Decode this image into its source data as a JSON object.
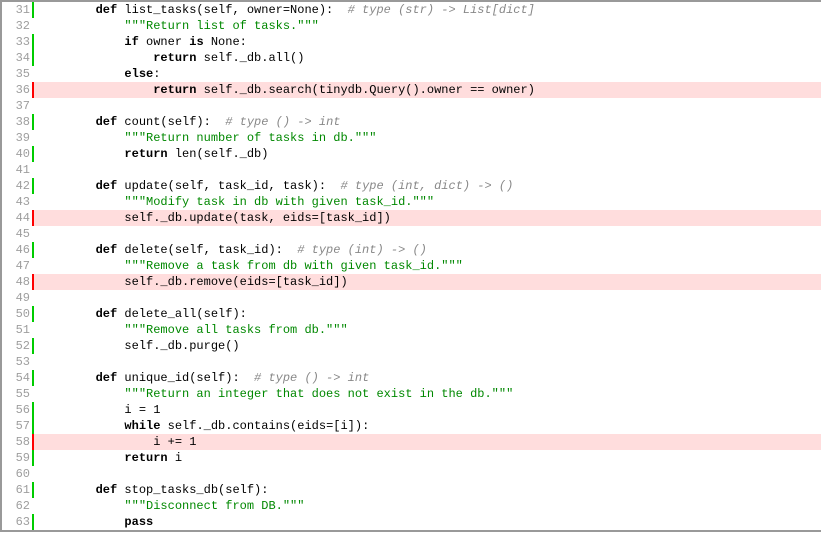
{
  "lines": [
    {
      "n": 31,
      "bar": "green",
      "status": "hit",
      "segments": [
        {
          "t": "        ",
          "c": ""
        },
        {
          "t": "def",
          "c": "kw"
        },
        {
          "t": " list_tasks(self, owner=None):  ",
          "c": ""
        },
        {
          "t": "# type (str) -> List[dict]",
          "c": "cmt"
        }
      ]
    },
    {
      "n": 32,
      "bar": "",
      "status": "none",
      "segments": [
        {
          "t": "            ",
          "c": ""
        },
        {
          "t": "\"\"\"Return list of tasks.\"\"\"",
          "c": "str"
        }
      ]
    },
    {
      "n": 33,
      "bar": "green",
      "status": "hit",
      "segments": [
        {
          "t": "            ",
          "c": ""
        },
        {
          "t": "if",
          "c": "kw"
        },
        {
          "t": " owner ",
          "c": ""
        },
        {
          "t": "is",
          "c": "kw"
        },
        {
          "t": " None:",
          "c": ""
        }
      ]
    },
    {
      "n": 34,
      "bar": "green",
      "status": "hit",
      "segments": [
        {
          "t": "                ",
          "c": ""
        },
        {
          "t": "return",
          "c": "kw"
        },
        {
          "t": " self._db.all()",
          "c": ""
        }
      ]
    },
    {
      "n": 35,
      "bar": "",
      "status": "none",
      "segments": [
        {
          "t": "            ",
          "c": ""
        },
        {
          "t": "else",
          "c": "kw"
        },
        {
          "t": ":",
          "c": ""
        }
      ]
    },
    {
      "n": 36,
      "bar": "red",
      "status": "miss",
      "segments": [
        {
          "t": "                ",
          "c": ""
        },
        {
          "t": "return",
          "c": "kw"
        },
        {
          "t": " self._db.search(tinydb.Query().owner == owner)",
          "c": ""
        }
      ]
    },
    {
      "n": 37,
      "bar": "",
      "status": "none",
      "segments": []
    },
    {
      "n": 38,
      "bar": "green",
      "status": "hit",
      "segments": [
        {
          "t": "        ",
          "c": ""
        },
        {
          "t": "def",
          "c": "kw"
        },
        {
          "t": " count(self):  ",
          "c": ""
        },
        {
          "t": "# type () -> int",
          "c": "cmt"
        }
      ]
    },
    {
      "n": 39,
      "bar": "",
      "status": "none",
      "segments": [
        {
          "t": "            ",
          "c": ""
        },
        {
          "t": "\"\"\"Return number of tasks in db.\"\"\"",
          "c": "str"
        }
      ]
    },
    {
      "n": 40,
      "bar": "green",
      "status": "hit",
      "segments": [
        {
          "t": "            ",
          "c": ""
        },
        {
          "t": "return",
          "c": "kw"
        },
        {
          "t": " len(self._db)",
          "c": ""
        }
      ]
    },
    {
      "n": 41,
      "bar": "",
      "status": "none",
      "segments": []
    },
    {
      "n": 42,
      "bar": "green",
      "status": "hit",
      "segments": [
        {
          "t": "        ",
          "c": ""
        },
        {
          "t": "def",
          "c": "kw"
        },
        {
          "t": " update(self, task_id, task):  ",
          "c": ""
        },
        {
          "t": "# type (int, dict) -> ()",
          "c": "cmt"
        }
      ]
    },
    {
      "n": 43,
      "bar": "",
      "status": "none",
      "segments": [
        {
          "t": "            ",
          "c": ""
        },
        {
          "t": "\"\"\"Modify task in db with given task_id.\"\"\"",
          "c": "str"
        }
      ]
    },
    {
      "n": 44,
      "bar": "red",
      "status": "miss",
      "segments": [
        {
          "t": "            self._db.update(task, eids=[task_id])",
          "c": ""
        }
      ]
    },
    {
      "n": 45,
      "bar": "",
      "status": "none",
      "segments": []
    },
    {
      "n": 46,
      "bar": "green",
      "status": "hit",
      "segments": [
        {
          "t": "        ",
          "c": ""
        },
        {
          "t": "def",
          "c": "kw"
        },
        {
          "t": " delete(self, task_id):  ",
          "c": ""
        },
        {
          "t": "# type (int) -> ()",
          "c": "cmt"
        }
      ]
    },
    {
      "n": 47,
      "bar": "",
      "status": "none",
      "segments": [
        {
          "t": "            ",
          "c": ""
        },
        {
          "t": "\"\"\"Remove a task from db with given task_id.\"\"\"",
          "c": "str"
        }
      ]
    },
    {
      "n": 48,
      "bar": "red",
      "status": "miss",
      "segments": [
        {
          "t": "            self._db.remove(eids=[task_id])",
          "c": ""
        }
      ]
    },
    {
      "n": 49,
      "bar": "",
      "status": "none",
      "segments": []
    },
    {
      "n": 50,
      "bar": "green",
      "status": "hit",
      "segments": [
        {
          "t": "        ",
          "c": ""
        },
        {
          "t": "def",
          "c": "kw"
        },
        {
          "t": " delete_all(self):",
          "c": ""
        }
      ]
    },
    {
      "n": 51,
      "bar": "",
      "status": "none",
      "segments": [
        {
          "t": "            ",
          "c": ""
        },
        {
          "t": "\"\"\"Remove all tasks from db.\"\"\"",
          "c": "str"
        }
      ]
    },
    {
      "n": 52,
      "bar": "green",
      "status": "hit",
      "segments": [
        {
          "t": "            self._db.purge()",
          "c": ""
        }
      ]
    },
    {
      "n": 53,
      "bar": "",
      "status": "none",
      "segments": []
    },
    {
      "n": 54,
      "bar": "green",
      "status": "hit",
      "segments": [
        {
          "t": "        ",
          "c": ""
        },
        {
          "t": "def",
          "c": "kw"
        },
        {
          "t": " unique_id(self):  ",
          "c": ""
        },
        {
          "t": "# type () -> int",
          "c": "cmt"
        }
      ]
    },
    {
      "n": 55,
      "bar": "",
      "status": "none",
      "segments": [
        {
          "t": "            ",
          "c": ""
        },
        {
          "t": "\"\"\"Return an integer that does not exist in the db.\"\"\"",
          "c": "str"
        }
      ]
    },
    {
      "n": 56,
      "bar": "green",
      "status": "hit",
      "segments": [
        {
          "t": "            i = 1",
          "c": ""
        }
      ]
    },
    {
      "n": 57,
      "bar": "green",
      "status": "hit",
      "segments": [
        {
          "t": "            ",
          "c": ""
        },
        {
          "t": "while",
          "c": "kw"
        },
        {
          "t": " self._db.contains(eids=[i]):",
          "c": ""
        }
      ]
    },
    {
      "n": 58,
      "bar": "red",
      "status": "miss",
      "segments": [
        {
          "t": "                i += 1",
          "c": ""
        }
      ]
    },
    {
      "n": 59,
      "bar": "green",
      "status": "hit",
      "segments": [
        {
          "t": "            ",
          "c": ""
        },
        {
          "t": "return",
          "c": "kw"
        },
        {
          "t": " i",
          "c": ""
        }
      ]
    },
    {
      "n": 60,
      "bar": "",
      "status": "none",
      "segments": []
    },
    {
      "n": 61,
      "bar": "green",
      "status": "hit",
      "segments": [
        {
          "t": "        ",
          "c": ""
        },
        {
          "t": "def",
          "c": "kw"
        },
        {
          "t": " stop_tasks_db(self):",
          "c": ""
        }
      ]
    },
    {
      "n": 62,
      "bar": "",
      "status": "none",
      "segments": [
        {
          "t": "            ",
          "c": ""
        },
        {
          "t": "\"\"\"Disconnect from DB.\"\"\"",
          "c": "str"
        }
      ]
    },
    {
      "n": 63,
      "bar": "green",
      "status": "hit",
      "segments": [
        {
          "t": "            ",
          "c": ""
        },
        {
          "t": "pass",
          "c": "kw"
        }
      ]
    }
  ]
}
